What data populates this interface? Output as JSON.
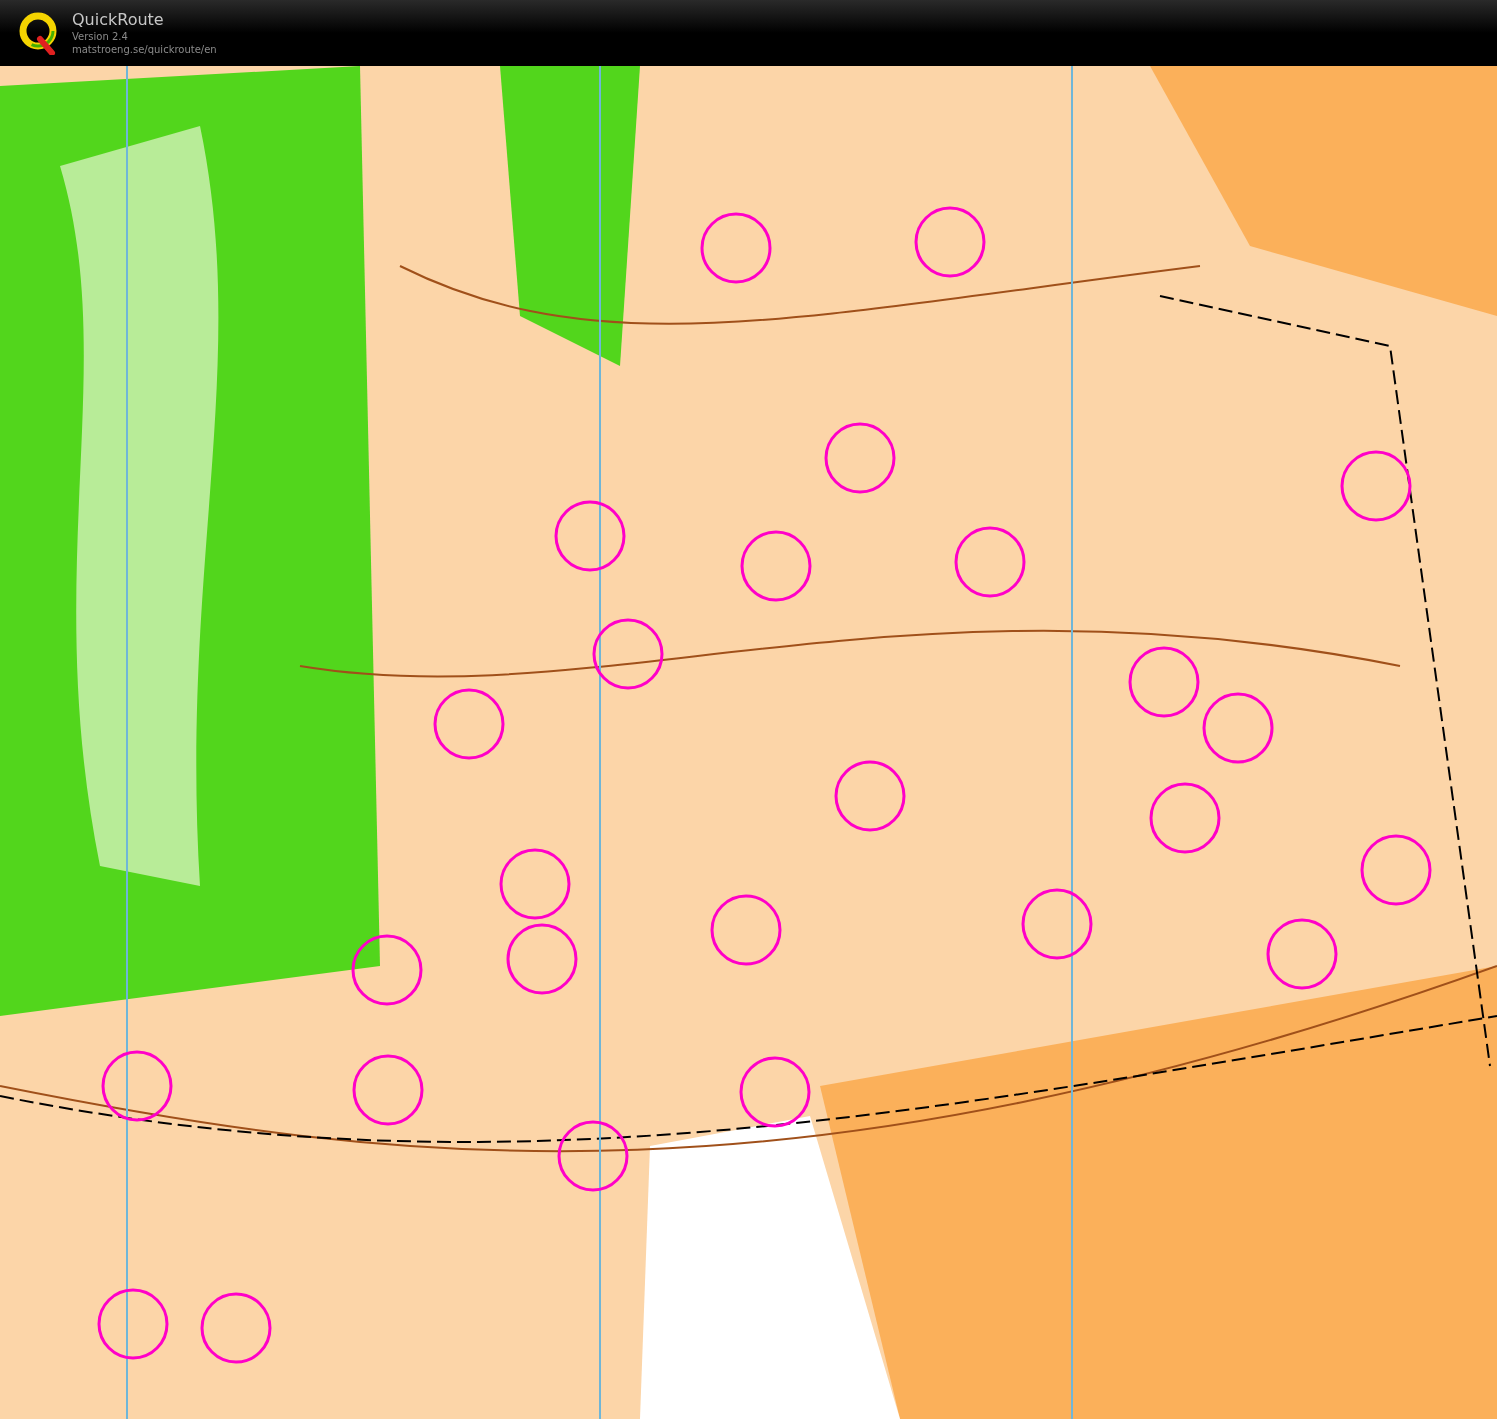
{
  "app": {
    "title": "QuickRoute",
    "version": "Version 2.4",
    "url": "matstroeng.se/quickroute/en"
  }
}
